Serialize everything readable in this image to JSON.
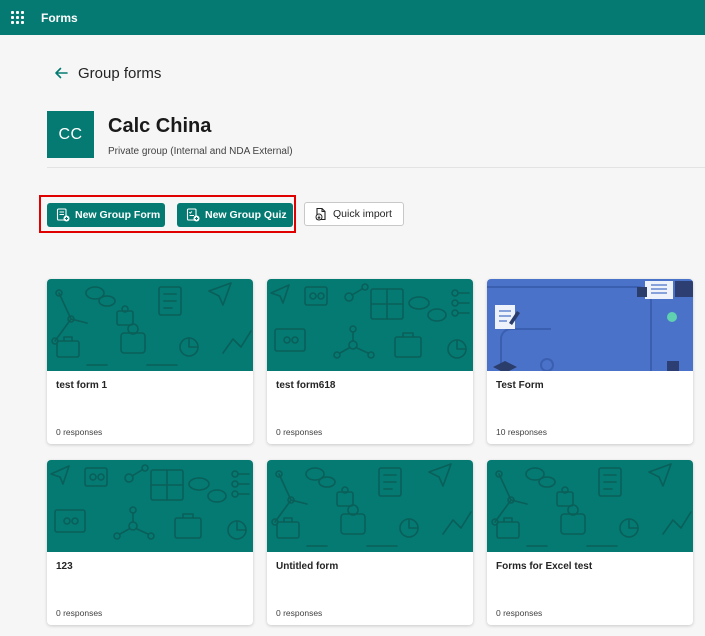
{
  "colors": {
    "brand": "#047a72",
    "teal_pattern": "#0f6f68",
    "quiz_blue": "#4a72c8",
    "highlight": "#e00000"
  },
  "header": {
    "app_name": "Forms",
    "waffle_icon": "waffle-icon"
  },
  "page": {
    "title": "Group forms",
    "back_icon": "arrow-left-icon"
  },
  "group": {
    "initials": "CC",
    "name": "Calc China",
    "description": "Private group (Internal and NDA External)"
  },
  "actions": {
    "new_form": "New Group Form",
    "new_quiz": "New Group Quiz",
    "quick_import": "Quick import"
  },
  "forms": [
    {
      "title": "test form 1",
      "responses": "0 responses",
      "theme": "teal"
    },
    {
      "title": "test form618",
      "responses": "0 responses",
      "theme": "teal"
    },
    {
      "title": "Test Form",
      "responses": "10 responses",
      "theme": "blue"
    },
    {
      "title": "123",
      "responses": "0 responses",
      "theme": "teal"
    },
    {
      "title": "Untitled form",
      "responses": "0 responses",
      "theme": "teal"
    },
    {
      "title": "Forms for Excel test",
      "responses": "0 responses",
      "theme": "teal"
    }
  ]
}
